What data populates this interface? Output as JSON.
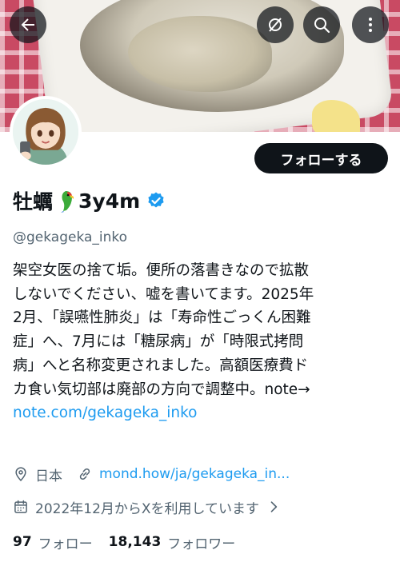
{
  "profile": {
    "display_name": "牡蠣",
    "display_suffix": "3y4m",
    "handle": "@gekageka_inko",
    "bio_lines": [
      "架空女医の捨て垢。便所の落書きなので拡散",
      "しないでください、嘘を書いてます。2025年",
      "2月、「誤嚥性肺炎」は「寿命性ごっくん困難",
      "症」へ、7月には「糖尿病」が「時限式拷問",
      "病」へと名称変更されました。高額医療費ド",
      "カ食い気切部は廃部の方向で調整中。note→"
    ],
    "bio_link": "note.com/gekageka_inko",
    "location": "日本",
    "website": "mond.how/ja/gekageka_in...",
    "joined": "2022年12月からXを利用しています",
    "following_count": "97",
    "following_label": "フォロー",
    "followers_count": "18,143",
    "followers_label": "フォロワー"
  },
  "actions": {
    "follow_label": "フォローする"
  },
  "icons": {
    "back": "back-arrow-icon",
    "mute": "mute-icon",
    "search": "search-icon",
    "more": "more-vertical-icon",
    "verified": "verified-badge-icon",
    "location": "location-pin-icon",
    "link": "link-icon",
    "calendar": "calendar-icon",
    "chevron": "chevron-right-icon"
  },
  "colors": {
    "accent": "#1d9bf0",
    "text": "#0f1419",
    "secondary": "#536471",
    "button_bg": "#0f1419"
  }
}
